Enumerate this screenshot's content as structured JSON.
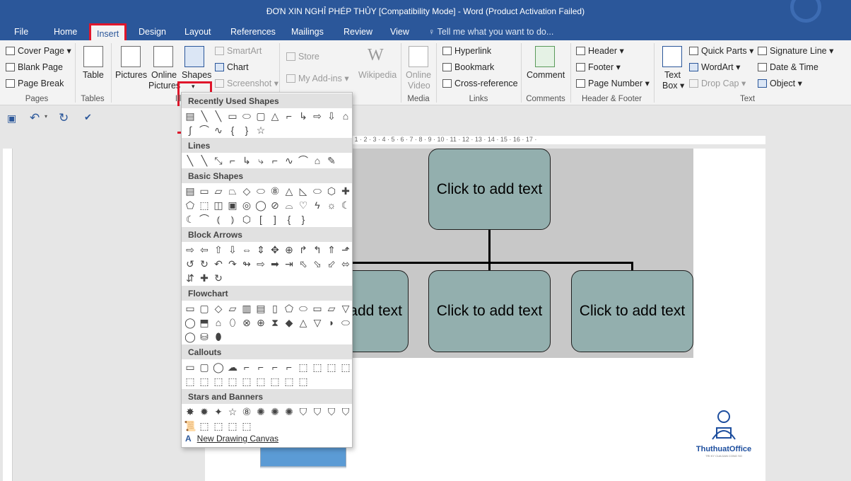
{
  "window": {
    "title": "ĐƠN XIN NGHỈ PHÉP THỦY [Compatibility Mode] - Word (Product Activation Failed)"
  },
  "tabs": [
    "File",
    "Home",
    "Insert",
    "Design",
    "Layout",
    "References",
    "Mailings",
    "Review",
    "View"
  ],
  "tell_me": "Tell me what you want to do...",
  "ribbon": {
    "pages": {
      "cover": "Cover Page",
      "blank": "Blank Page",
      "break": "Page Break",
      "group": "Pages"
    },
    "tables": {
      "table": "Table",
      "group": "Tables"
    },
    "illus": {
      "pictures": "Pictures",
      "online1": "Online",
      "online2": "Pictures",
      "shapes": "Shapes",
      "smartart": "SmartArt",
      "chart": "Chart",
      "screenshot": "Screenshot",
      "group": "Ill"
    },
    "addins": {
      "store": "Store",
      "myaddins": "My Add-ins",
      "wikipedia": "Wikipedia"
    },
    "media": {
      "video1": "Online",
      "video2": "Video",
      "group": "Media"
    },
    "links": {
      "hyperlink": "Hyperlink",
      "bookmark": "Bookmark",
      "crossref": "Cross-reference",
      "group": "Links"
    },
    "comments": {
      "comment": "Comment",
      "group": "Comments"
    },
    "hf": {
      "header": "Header",
      "footer": "Footer",
      "pagenum": "Page Number",
      "group": "Header & Footer"
    },
    "text": {
      "tb1": "Text",
      "tb2": "Box",
      "quickparts": "Quick Parts",
      "wordart": "WordArt",
      "dropcap": "Drop Cap",
      "sigline": "Signature Line",
      "datetime": "Date & Time",
      "object": "Object",
      "group": "Text"
    }
  },
  "ruler": "· 1 · 2 · 3 · 4 · 5 · 6 · 7 · 8 · 9 · 10 · 11 · 12 · 13 · 14 · 15 · 16 · 17 ·",
  "shapes_menu": {
    "sections": [
      {
        "title": "Recently Used Shapes",
        "rows": [
          [
            "▤",
            "╲",
            "╲",
            "▭",
            "⬭",
            "▢",
            "△",
            "⌐",
            "↳",
            "⇨",
            "⇩",
            "⌂"
          ],
          [
            "∫",
            "⌒",
            "∿",
            "{",
            "}",
            "☆"
          ]
        ]
      },
      {
        "title": "Lines",
        "rows": [
          [
            "╲",
            "╲",
            "⤡",
            "⌐",
            "↳",
            "⤷",
            "⌐",
            "∿",
            "⌒",
            "⌂",
            "✎"
          ]
        ]
      },
      {
        "title": "Basic Shapes",
        "rows": [
          [
            "▤",
            "▭",
            "▱",
            "⏢",
            "◇",
            "⬭",
            "⑧",
            "△",
            "◺",
            "⬭",
            "⬡",
            "✚"
          ],
          [
            "⬠",
            "⬚",
            "◫",
            "▣",
            "◎",
            "◯",
            "⊘",
            "⌓",
            "♡",
            "ϟ",
            "☼",
            "☾"
          ],
          [
            "☾",
            "⌒",
            "⦅",
            "⦆",
            "⬡",
            "[",
            "]",
            "{",
            "}"
          ]
        ]
      },
      {
        "title": "Block Arrows",
        "rows": [
          [
            "⇨",
            "⇦",
            "⇧",
            "⇩",
            "⇔",
            "⇕",
            "✥",
            "⊕",
            "↱",
            "↰",
            "⇑",
            "⬏"
          ],
          [
            "↺",
            "↻",
            "↶",
            "↷",
            "↬",
            "⇨",
            "➡",
            "⇥",
            "⬁",
            "⬂",
            "⬃",
            "⬄"
          ],
          [
            "⇵",
            "✚",
            "↻"
          ]
        ]
      },
      {
        "title": "Flowchart",
        "rows": [
          [
            "▭",
            "▢",
            "◇",
            "▱",
            "▥",
            "▤",
            "▯",
            "⬠",
            "⬭",
            "▭",
            "▱",
            "▽"
          ],
          [
            "◯",
            "⬒",
            "⌂",
            "⬯",
            "⊗",
            "⊕",
            "⧗",
            "◆",
            "△",
            "▽",
            "◗",
            "⬭"
          ],
          [
            "◯",
            "⛁",
            "⬮"
          ]
        ]
      },
      {
        "title": "Callouts",
        "rows": [
          [
            "▭",
            "▢",
            "◯",
            "☁",
            "⌐",
            "⌐",
            "⌐",
            "⌐",
            "⬚",
            "⬚",
            "⬚",
            "⬚"
          ],
          [
            "⬚",
            "⬚",
            "⬚",
            "⬚",
            "⬚",
            "⬚",
            "⬚",
            "⬚",
            "⬚"
          ]
        ]
      },
      {
        "title": "Stars and Banners",
        "rows": [
          [
            "✸",
            "✹",
            "✦",
            "☆",
            "⑧",
            "✺",
            "✺",
            "✺",
            "⛉",
            "⛉",
            "⛉",
            "⛉"
          ],
          [
            "📜",
            "⬚",
            "⬚",
            "⬚",
            "⬚"
          ]
        ]
      }
    ],
    "new_canvas": "New Drawing Canvas"
  },
  "doc": {
    "top": "Click to add text",
    "left": "Click to add text",
    "mid": "Click to add text",
    "right": "Click to add text"
  },
  "logo": {
    "name": "ThuthuatOffice",
    "sub": "TRI KY CUA DAN CONG SO"
  },
  "colors": {
    "brand": "#2b579a",
    "highlight": "#e0162b",
    "node": "#93afae"
  }
}
